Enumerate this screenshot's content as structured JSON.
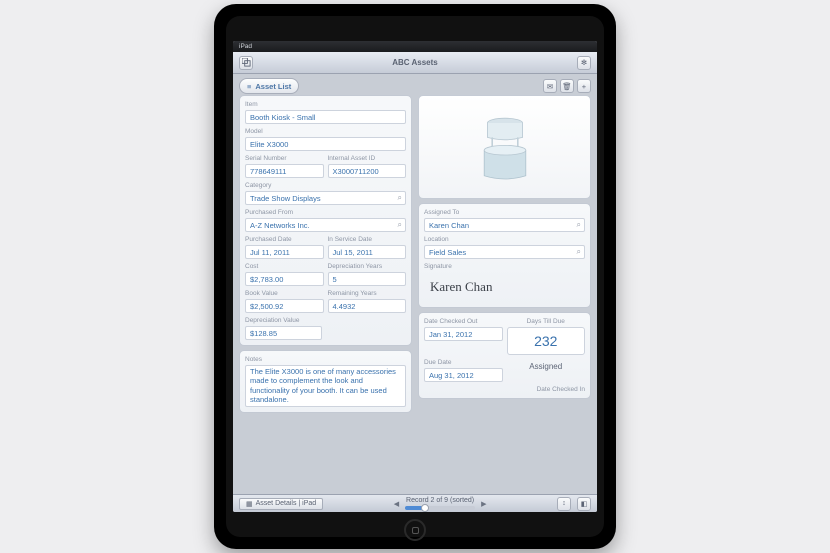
{
  "status": {
    "device": "iPad"
  },
  "nav": {
    "title": "ABC Assets",
    "asset_list": "Asset List"
  },
  "left": {
    "item_lbl": "Item",
    "item": "Booth Kiosk - Small",
    "model_lbl": "Model",
    "model": "Elite X3000",
    "serial_lbl": "Serial Number",
    "serial": "778649111",
    "assetid_lbl": "Internal Asset ID",
    "assetid": "X3000711200",
    "category_lbl": "Category",
    "category": "Trade Show Displays",
    "pfrom_lbl": "Purchased From",
    "pfrom": "A-Z Networks Inc.",
    "pdate_lbl": "Purchased Date",
    "pdate": "Jul 11, 2011",
    "svcdate_lbl": "In Service Date",
    "svcdate": "Jul 15, 2011",
    "cost_lbl": "Cost",
    "cost": "$2,783.00",
    "depy_lbl": "Depreciation Years",
    "depy": "5",
    "book_lbl": "Book Value",
    "book": "$2,500.92",
    "remy_lbl": "Remaining Years",
    "remy": "4.4932",
    "depv_lbl": "Depreciation Value",
    "depv": "$128.85",
    "notes_lbl": "Notes",
    "notes": "The Elite X3000 is one of many accessories made to complement the look and functionality of your booth. It can be used standalone."
  },
  "right": {
    "assigned_lbl": "Assigned To",
    "assigned": "Karen Chan",
    "location_lbl": "Location",
    "location": "Field Sales",
    "sig_lbl": "Signature",
    "sig": "Karen Chan",
    "dout_lbl": "Date Checked Out",
    "dout": "Jan 31, 2012",
    "days_lbl": "Days Till Due",
    "days": "232",
    "due_lbl": "Due Date",
    "due": "Aug 31, 2012",
    "status": "Assigned",
    "din_lbl": "Date Checked In"
  },
  "bottom": {
    "layout": "Asset Details | iPad",
    "record": "Record 2 of 9 (sorted)"
  }
}
